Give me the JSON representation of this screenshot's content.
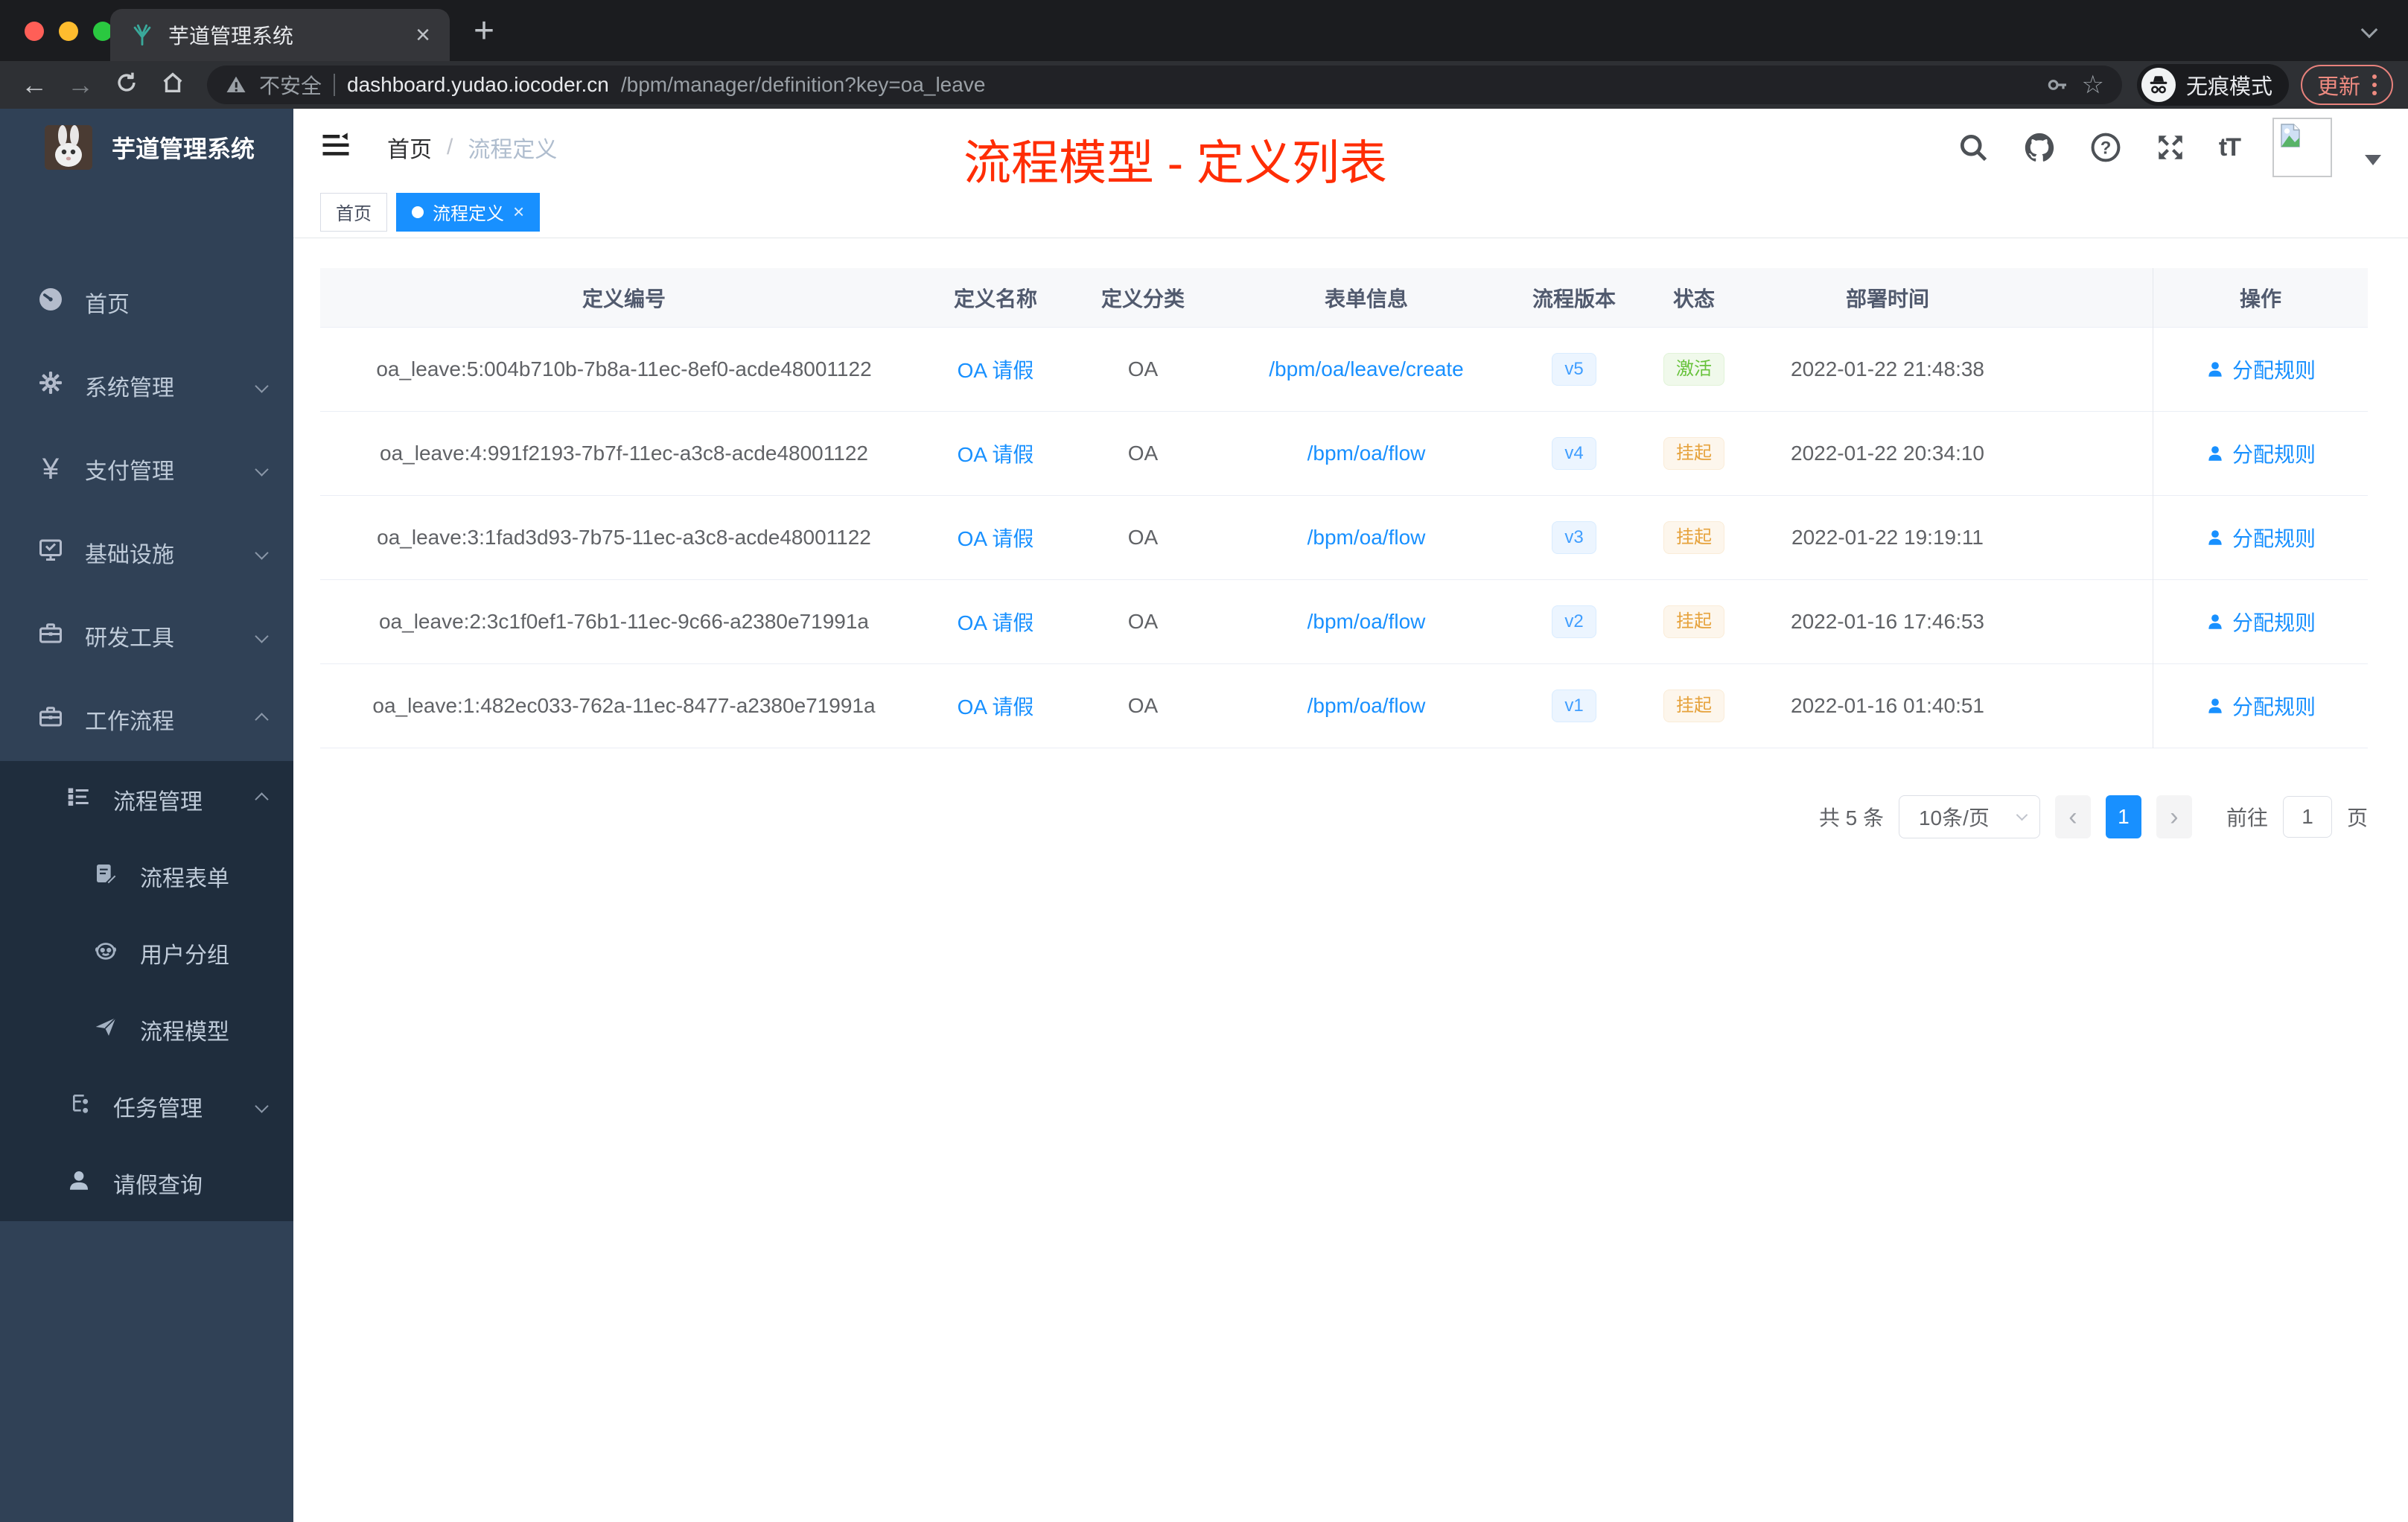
{
  "browser": {
    "tab_title": "芋道管理系统",
    "security_label": "不安全",
    "url_host": "dashboard.yudao.iocoder.cn",
    "url_path": "/bpm/manager/definition?key=oa_leave",
    "incognito_label": "无痕模式",
    "update_label": "更新",
    "new_tab_label": "+",
    "tab_close_label": "×"
  },
  "sidebar": {
    "app_title": "芋道管理系统",
    "items": [
      {
        "label": "首页",
        "icon": "dashboard-icon"
      },
      {
        "label": "系统管理",
        "icon": "gear-icon"
      },
      {
        "label": "支付管理",
        "icon": "yen-icon"
      },
      {
        "label": "基础设施",
        "icon": "monitor-icon"
      },
      {
        "label": "研发工具",
        "icon": "toolbox-icon"
      },
      {
        "label": "工作流程",
        "icon": "toolbox-icon"
      },
      {
        "label": "流程管理",
        "icon": "list-icon"
      },
      {
        "label": "流程表单",
        "icon": "form-icon"
      },
      {
        "label": "用户分组",
        "icon": "face-icon"
      },
      {
        "label": "流程模型",
        "icon": "paper-plane-icon"
      },
      {
        "label": "任务管理",
        "icon": "tree-icon"
      },
      {
        "label": "请假查询",
        "icon": "person-icon"
      }
    ]
  },
  "navbar": {
    "breadcrumb_home": "首页",
    "breadcrumb_sep": "/",
    "breadcrumb_current": "流程定义",
    "annotation": "流程模型 - 定义列表",
    "fontsize_label": "tT"
  },
  "tags": {
    "inactive": "首页",
    "active": "流程定义",
    "close": "×"
  },
  "table": {
    "headers": {
      "id": "定义编号",
      "name": "定义名称",
      "category": "定义分类",
      "form": "表单信息",
      "version": "流程版本",
      "status": "状态",
      "deploy_time": "部署时间",
      "action": "操作"
    },
    "rows": [
      {
        "id": "oa_leave:5:004b710b-7b8a-11ec-8ef0-acde48001122",
        "name": "OA 请假",
        "category": "OA",
        "form": "/bpm/oa/leave/create",
        "version": "v5",
        "status": "激活",
        "status_class": "success",
        "time": "2022-01-22 21:48:38",
        "action": "分配规则"
      },
      {
        "id": "oa_leave:4:991f2193-7b7f-11ec-a3c8-acde48001122",
        "name": "OA 请假",
        "category": "OA",
        "form": "/bpm/oa/flow",
        "version": "v4",
        "status": "挂起",
        "status_class": "warning",
        "time": "2022-01-22 20:34:10",
        "action": "分配规则"
      },
      {
        "id": "oa_leave:3:1fad3d93-7b75-11ec-a3c8-acde48001122",
        "name": "OA 请假",
        "category": "OA",
        "form": "/bpm/oa/flow",
        "version": "v3",
        "status": "挂起",
        "status_class": "warning",
        "time": "2022-01-22 19:19:11",
        "action": "分配规则"
      },
      {
        "id": "oa_leave:2:3c1f0ef1-76b1-11ec-9c66-a2380e71991a",
        "name": "OA 请假",
        "category": "OA",
        "form": "/bpm/oa/flow",
        "version": "v2",
        "status": "挂起",
        "status_class": "warning",
        "time": "2022-01-16 17:46:53",
        "action": "分配规则"
      },
      {
        "id": "oa_leave:1:482ec033-762a-11ec-8477-a2380e71991a",
        "name": "OA 请假",
        "category": "OA",
        "form": "/bpm/oa/flow",
        "version": "v1",
        "status": "挂起",
        "status_class": "warning",
        "time": "2022-01-16 01:40:51",
        "action": "分配规则"
      }
    ]
  },
  "pagination": {
    "total": "共 5 条",
    "page_size": "10条/页",
    "current_page": "1",
    "goto_label": "前往",
    "goto_value": "1",
    "goto_suffix": "页"
  },
  "colors": {
    "theme_blue": "#1890ff",
    "badge_blue": "#409eff",
    "success_green": "#67c23a",
    "warning_orange": "#e6a23c",
    "annotation_red": "#ff2d05",
    "sidebar_bg": "#304156",
    "submenu_bg": "#1f2d3d",
    "traffic_red": "#ff5f57",
    "traffic_yellow": "#febc2e",
    "traffic_green": "#2ac840"
  }
}
